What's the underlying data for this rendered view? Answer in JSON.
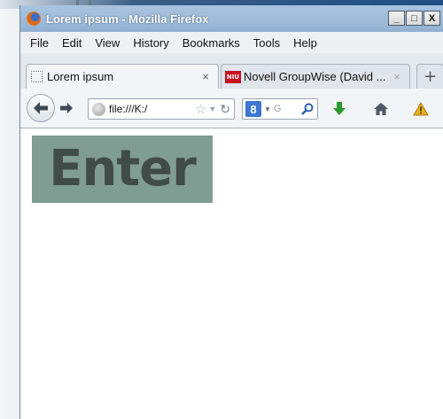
{
  "window": {
    "title": "Lorem ipsum - Mozilla Firefox",
    "controls": {
      "minimize": "_",
      "maximize": "□",
      "close": "X"
    }
  },
  "menu": {
    "items": [
      "File",
      "Edit",
      "View",
      "History",
      "Bookmarks",
      "Tools",
      "Help"
    ]
  },
  "tabs": [
    {
      "label": "Lorem ipsum",
      "active": true,
      "close": "×"
    },
    {
      "label": "Novell GroupWise (David ...",
      "active": false,
      "close": "×",
      "favicon_text": "NIU"
    }
  ],
  "newtab_label": "+",
  "navbar": {
    "url": "file:///K:/",
    "search_engine": "Google",
    "search_engine_badge": "8",
    "search_hint": "G"
  },
  "page": {
    "button_label": "Enter",
    "button_bg": "#7f9d92",
    "button_text_color": "#414b48"
  },
  "colors": {
    "titlebar": "#9dbad8",
    "download_arrow": "#2a9a2a",
    "warning": "#e8b020"
  }
}
